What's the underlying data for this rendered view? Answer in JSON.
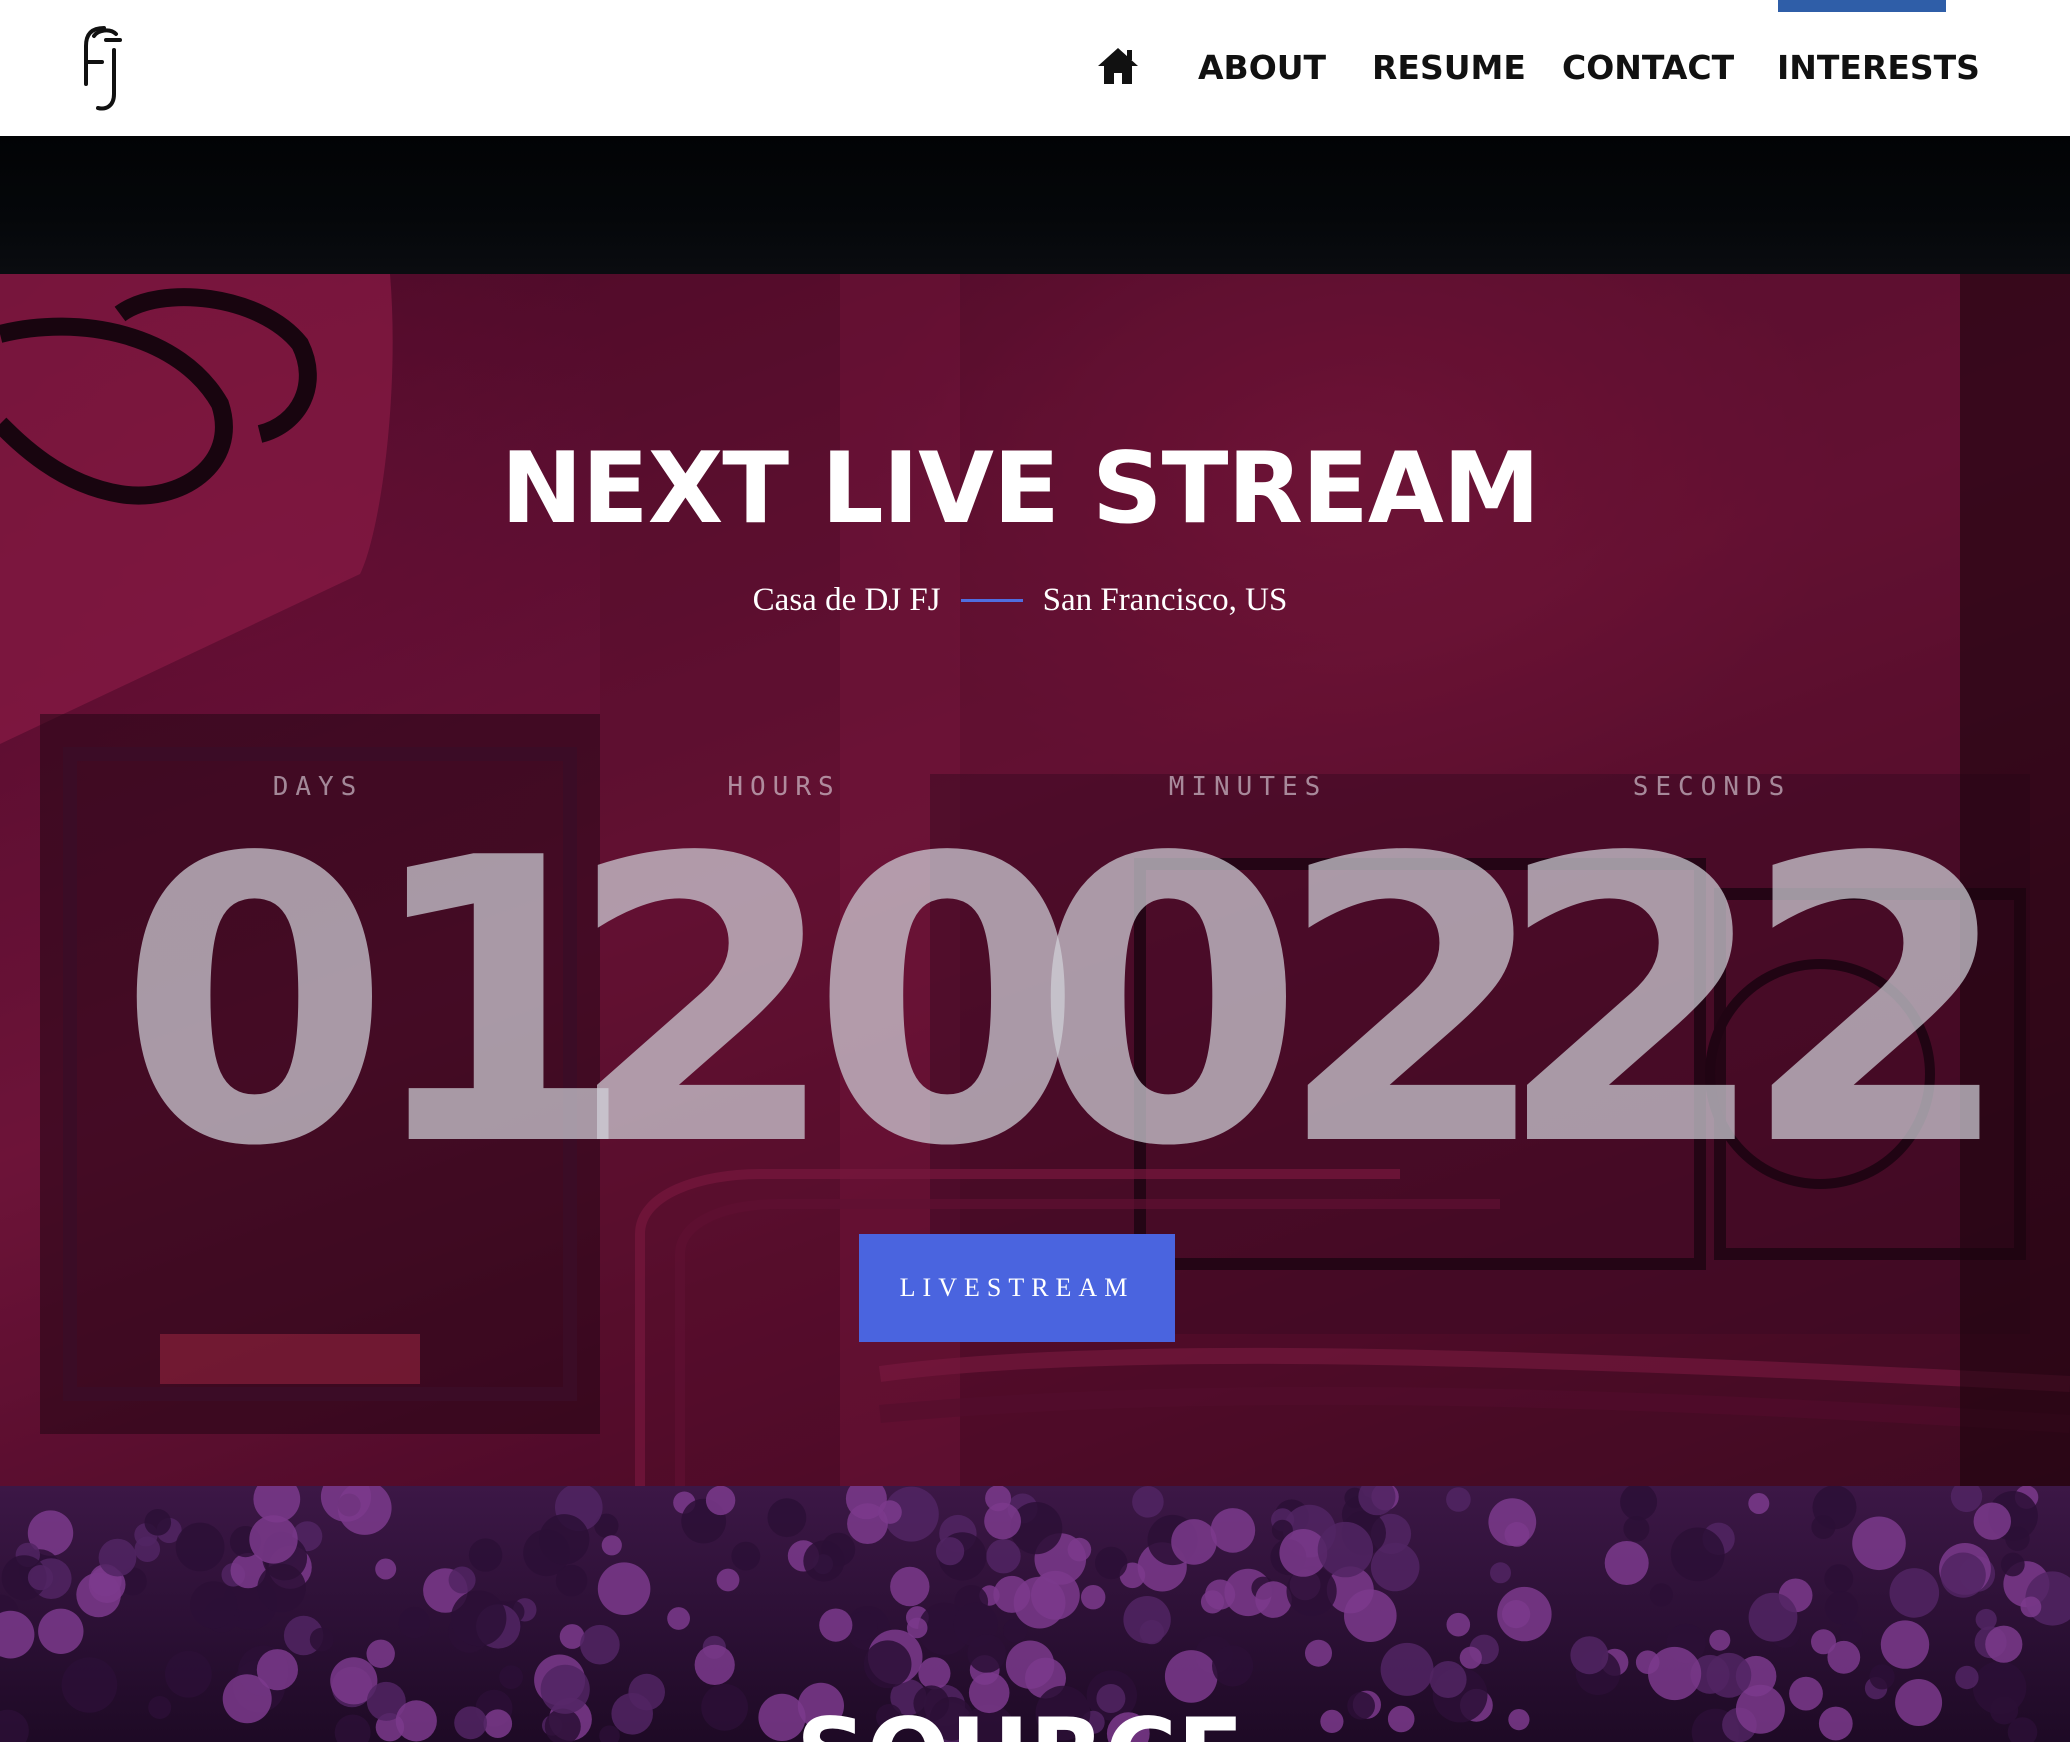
{
  "nav": {
    "items": [
      {
        "label": "ABOUT"
      },
      {
        "label": "RESUME"
      },
      {
        "label": "CONTACT"
      },
      {
        "label": "INTERESTS"
      }
    ],
    "active": "INTERESTS",
    "active_color": "#2f5ea8",
    "home_icon": "home-icon",
    "logo": "FJ"
  },
  "hero": {
    "title": "NEXT LIVE STREAM",
    "venue": "Casa de DJ FJ",
    "location": "San Francisco, US",
    "countdown": {
      "days_label": "DAYS",
      "days": "01",
      "hours_label": "HOURS",
      "hours": "20",
      "minutes_label": "MINUTES",
      "minutes": "02",
      "seconds_label": "SECONDS",
      "seconds": "22"
    },
    "button_label": "LIVESTREAM",
    "button_color": "#4a64df"
  },
  "next_section": {
    "title": "SOURCE"
  }
}
